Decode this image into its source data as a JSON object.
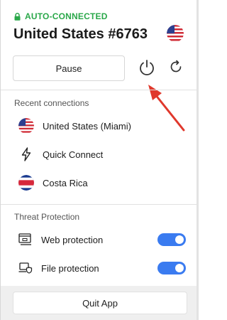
{
  "header": {
    "status": "AUTO-CONNECTED",
    "server_name": "United States #6763"
  },
  "controls": {
    "pause_label": "Pause"
  },
  "recent": {
    "heading": "Recent connections",
    "items": [
      {
        "label": "United States (Miami)",
        "icon": "us-flag-icon"
      },
      {
        "label": "Quick Connect",
        "icon": "bolt-icon"
      },
      {
        "label": "Costa Rica",
        "icon": "costa-rica-flag-icon"
      }
    ]
  },
  "threat_protection": {
    "heading": "Threat Protection",
    "items": [
      {
        "label": "Web protection",
        "icon": "browser-shield-icon",
        "enabled": true
      },
      {
        "label": "File protection",
        "icon": "laptop-shield-icon",
        "enabled": true
      }
    ]
  },
  "footer": {
    "quit_label": "Quit App"
  },
  "colors": {
    "status_green": "#2aa84a",
    "toggle_blue": "#3a7bf0",
    "arrow_red": "#e0382c"
  }
}
